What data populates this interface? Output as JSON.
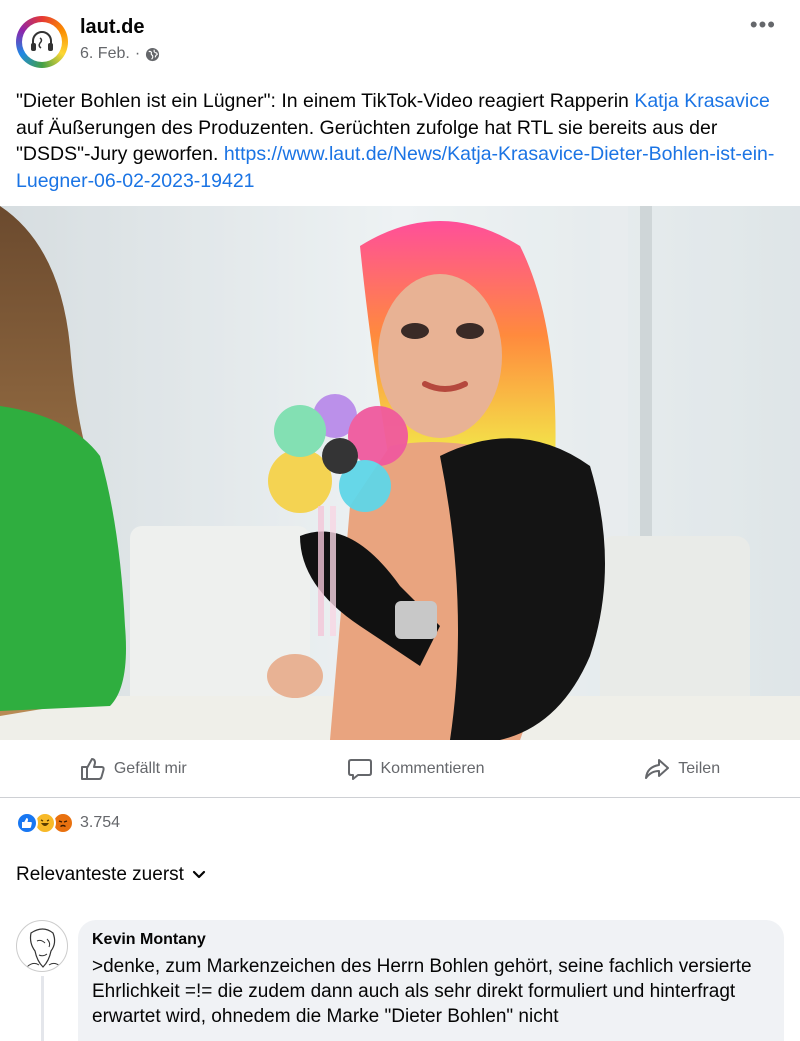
{
  "post": {
    "page_name": "laut.de",
    "date": "6. Feb.",
    "separator": "·",
    "text_before": "\"Dieter Bohlen ist ein Lügner\": In einem TikTok-Video reagiert Rapperin ",
    "mention": "Katja Krasavice",
    "text_after": " auf Äußerungen des Produzenten. Gerüchten zufolge hat RTL sie bereits aus der \"DSDS\"-Jury geworfen. ",
    "link": "https://www.laut.de/News/Katja-Krasavice-Dieter-Bohlen-ist-ein-Luegner-06-02-2023-19421"
  },
  "actions": {
    "like": "Gefällt mir",
    "comment": "Kommentieren",
    "share": "Teilen"
  },
  "reactions": {
    "count": "3.754",
    "icons": [
      "like-icon",
      "haha-icon",
      "angry-icon"
    ]
  },
  "sort": {
    "label": "Relevanteste zuerst"
  },
  "comment": {
    "author": "Kevin Montany",
    "text": ">denke, zum Markenzeichen des Herrn Bohlen gehört, seine fachlich versierte Ehrlichkeit =!= die zudem dann auch als sehr direkt formuliert und hinterfragt erwartet wird, ohnedem die Marke \"Dieter Bohlen\" nicht"
  },
  "colors": {
    "link": "#1b74e4",
    "secondary_text": "#65676b",
    "like_blue": "#1877f2",
    "haha_yellow": "#f7b928",
    "angry_orange": "#e9710f",
    "comment_bubble": "#f0f2f5"
  }
}
